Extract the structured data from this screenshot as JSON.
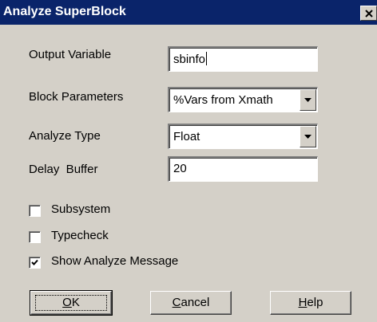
{
  "dialog": {
    "title": "Analyze SuperBlock",
    "close_glyph": "close-icon"
  },
  "fields": {
    "output_variable": {
      "label": "Output Variable",
      "value": "sbinfo"
    },
    "block_parameters": {
      "label": "Block Parameters",
      "value": "%Vars from Xmath"
    },
    "analyze_type": {
      "label": "Analyze Type",
      "value": "Float"
    },
    "delay_buffer": {
      "label": "Delay  Buffer",
      "value": "20"
    }
  },
  "checkboxes": {
    "subsystem": {
      "label": "Subsystem",
      "checked": false
    },
    "typecheck": {
      "label": "Typecheck",
      "checked": false
    },
    "show_analyze_message": {
      "label": "Show Analyze Message",
      "checked": true
    }
  },
  "buttons": {
    "ok": {
      "mnemonic": "O",
      "rest": "K"
    },
    "cancel": {
      "mnemonic": "C",
      "rest": "ancel"
    },
    "help": {
      "mnemonic": "H",
      "rest": "elp"
    }
  },
  "colors": {
    "titlebar": "#0a246a",
    "dialog_face": "#d4d0c8"
  }
}
